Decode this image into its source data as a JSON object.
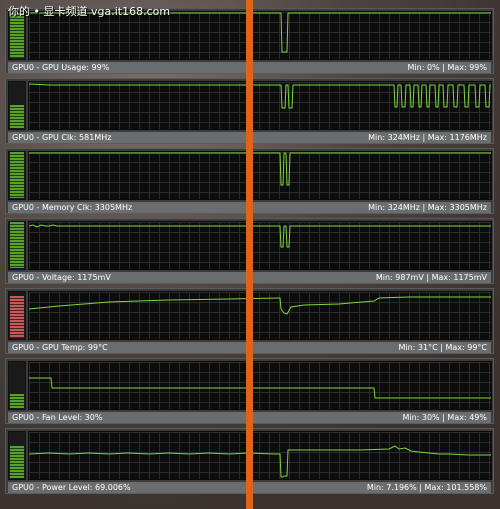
{
  "watermark": "你的 • 显卡频道 vga.it168.com",
  "colors": {
    "trace": "#7fd83a",
    "bar_green": "#5aa12b",
    "bar_red": "#c45a5a",
    "divider": "#e0631a"
  },
  "panels": [
    {
      "name": "GPU0 - GPU Usage: 99%",
      "range": "Min: 0% | Max: 99%",
      "level": 0.99,
      "bar": "green"
    },
    {
      "name": "GPU0 - GPU Clk: 581MHz",
      "range": "Min: 324MHz | Max: 1176MHz",
      "level": 0.49,
      "bar": "green"
    },
    {
      "name": "GPU0 - Memory Clk: 3305MHz",
      "range": "Min: 324MHz | Max: 3305MHz",
      "level": 1.0,
      "bar": "green"
    },
    {
      "name": "GPU0 - Voltage: 1175mV",
      "range": "Min: 987mV | Max: 1175mV",
      "level": 1.0,
      "bar": "green"
    },
    {
      "name": "GPU0 - GPU Temp: 99°C",
      "range": "Min: 31°C | Max: 99°C",
      "level": 0.9,
      "bar": "red"
    },
    {
      "name": "GPU0 - Fan Level: 30%",
      "range": "Min: 30% | Max: 49%",
      "level": 0.3,
      "bar": "green"
    },
    {
      "name": "GPU0 - Power Level: 69.006%",
      "range": "Min: 7.196% | Max: 101.558%",
      "level": 0.69,
      "bar": "green"
    }
  ]
}
